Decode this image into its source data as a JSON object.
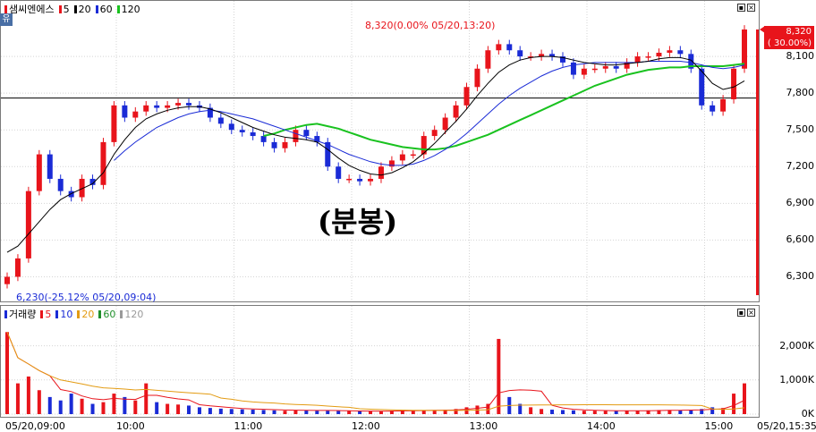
{
  "price_legend": {
    "name": "샘씨엔에스",
    "ma": [
      {
        "label": "5",
        "color": "#e8141b"
      },
      {
        "label": "20",
        "color": "#000000"
      },
      {
        "label": "60",
        "color": "#1a2bd6"
      },
      {
        "label": "120",
        "color": "#19c21f"
      }
    ]
  },
  "volume_legend": {
    "name": "거래량",
    "ma": [
      {
        "label": "5",
        "color": "#e8141b"
      },
      {
        "label": "10",
        "color": "#1a2bd6"
      },
      {
        "label": "20",
        "color": "#e39b12"
      },
      {
        "label": "60",
        "color": "#1f8f2a"
      },
      {
        "label": "120",
        "color": "#9a9a9a"
      }
    ]
  },
  "corner_icon": "유",
  "watermark": "(분봉)",
  "high_annotation": "8,320(0.00% 05/20,13:20)",
  "low_annotation": "6,230(-25.12% 05/20,09:04)",
  "current_price": "8,320",
  "current_change": "( 30.00%)",
  "last_time": "05/20,15:35",
  "colors": {
    "up": "#e8141b",
    "down": "#1a2bd6",
    "badge": "#e8141b"
  },
  "chart_data": {
    "type": "candlestick",
    "date": "05/20",
    "x_labels": [
      "05/20,09:00",
      "10:00",
      "11:00",
      "12:00",
      "13:00",
      "14:00",
      "15:00",
      "05/20,15:35"
    ],
    "price_axis": {
      "ticks": [
        "8,100",
        "7,800",
        "7,500",
        "7,200",
        "6,900",
        "6,600",
        "6,300"
      ],
      "range": [
        6150,
        8400
      ]
    },
    "volume_axis": {
      "ticks": [
        "2,000K",
        "1,000K",
        "0K"
      ],
      "range": [
        0,
        2800
      ]
    },
    "horizontal_line": 7760,
    "close": [
      6300,
      6450,
      7000,
      7300,
      7100,
      7000,
      6950,
      7100,
      7050,
      7400,
      7700,
      7600,
      7650,
      7700,
      7680,
      7700,
      7720,
      7700,
      7680,
      7600,
      7550,
      7500,
      7480,
      7450,
      7400,
      7350,
      7400,
      7500,
      7450,
      7400,
      7200,
      7100,
      7100,
      7080,
      7100,
      7200,
      7250,
      7300,
      7300,
      7450,
      7500,
      7600,
      7700,
      7850,
      8000,
      8150,
      8200,
      8150,
      8100,
      8100,
      8120,
      8100,
      8050,
      7950,
      8000,
      8000,
      8020,
      8000,
      8050,
      8100,
      8100,
      8130,
      8150,
      8120,
      8000,
      7700,
      7650,
      7750,
      8000,
      8320
    ],
    "price_line_5": [
      6300,
      6400,
      6600,
      6900,
      7050,
      7150,
      7050,
      7000,
      7050,
      7200,
      7450,
      7600,
      7650,
      7680,
      7680,
      7690,
      7700,
      7700,
      7680,
      7620,
      7560,
      7510,
      7480,
      7450,
      7410,
      7380,
      7390,
      7430,
      7440,
      7420,
      7300,
      7180,
      7110,
      7090,
      7090,
      7150,
      7220,
      7280,
      7320,
      7420,
      7500,
      7590,
      7690,
      7820,
      7960,
      8090,
      8180,
      8160,
      8120,
      8100,
      8110,
      8100,
      8060,
      7990,
      7990,
      8000,
      8010,
      8010,
      8040,
      8080,
      8100,
      8120,
      8140,
      8120,
      8030,
      7800,
      7690,
      7720,
      7900,
      8180
    ],
    "price_line_20": [
      6500,
      6550,
      6650,
      6750,
      6850,
      6930,
      6980,
      7020,
      7060,
      7150,
      7300,
      7420,
      7520,
      7590,
      7630,
      7660,
      7680,
      7690,
      7690,
      7670,
      7640,
      7600,
      7560,
      7520,
      7490,
      7460,
      7440,
      7430,
      7420,
      7400,
      7340,
      7270,
      7210,
      7170,
      7140,
      7130,
      7150,
      7190,
      7240,
      7310,
      7390,
      7480,
      7570,
      7670,
      7780,
      7880,
      7970,
      8030,
      8070,
      8090,
      8100,
      8100,
      8090,
      8070,
      8050,
      8040,
      8030,
      8030,
      8040,
      8050,
      8060,
      8080,
      8090,
      8090,
      8070,
      7980,
      7880,
      7830,
      7850,
      7900
    ],
    "price_line_60": [
      null,
      null,
      null,
      null,
      null,
      null,
      null,
      null,
      null,
      null,
      7250,
      7330,
      7400,
      7460,
      7520,
      7560,
      7600,
      7630,
      7650,
      7660,
      7650,
      7630,
      7610,
      7590,
      7560,
      7530,
      7500,
      7470,
      7440,
      7410,
      7380,
      7340,
      7300,
      7270,
      7240,
      7220,
      7210,
      7210,
      7220,
      7250,
      7290,
      7340,
      7400,
      7470,
      7550,
      7630,
      7710,
      7780,
      7840,
      7890,
      7940,
      7980,
      8010,
      8030,
      8040,
      8050,
      8050,
      8050,
      8050,
      8050,
      8060,
      8060,
      8060,
      8060,
      8050,
      8030,
      8010,
      8000,
      8010,
      8030
    ],
    "price_line_120": [
      null,
      null,
      null,
      null,
      null,
      null,
      null,
      null,
      null,
      null,
      null,
      null,
      null,
      null,
      null,
      null,
      null,
      null,
      null,
      null,
      null,
      null,
      null,
      null,
      7450,
      7470,
      7500,
      7520,
      7540,
      7550,
      7530,
      7510,
      7480,
      7450,
      7420,
      7400,
      7380,
      7360,
      7350,
      7340,
      7340,
      7350,
      7370,
      7400,
      7430,
      7460,
      7500,
      7540,
      7580,
      7620,
      7660,
      7700,
      7740,
      7780,
      7820,
      7860,
      7890,
      7920,
      7950,
      7970,
      7990,
      8000,
      8010,
      8010,
      8020,
      8020,
      8020,
      8020,
      8030,
      8040
    ],
    "volume": [
      2400,
      900,
      1100,
      700,
      500,
      400,
      600,
      450,
      300,
      350,
      600,
      500,
      400,
      900,
      350,
      300,
      280,
      250,
      200,
      180,
      160,
      150,
      140,
      130,
      120,
      110,
      100,
      120,
      110,
      100,
      100,
      90,
      90,
      80,
      80,
      90,
      100,
      120,
      100,
      110,
      120,
      130,
      150,
      200,
      250,
      300,
      2200,
      500,
      300,
      200,
      150,
      130,
      120,
      110,
      100,
      100,
      90,
      90,
      100,
      100,
      110,
      120,
      120,
      110,
      130,
      150,
      200,
      180,
      600,
      900
    ]
  }
}
